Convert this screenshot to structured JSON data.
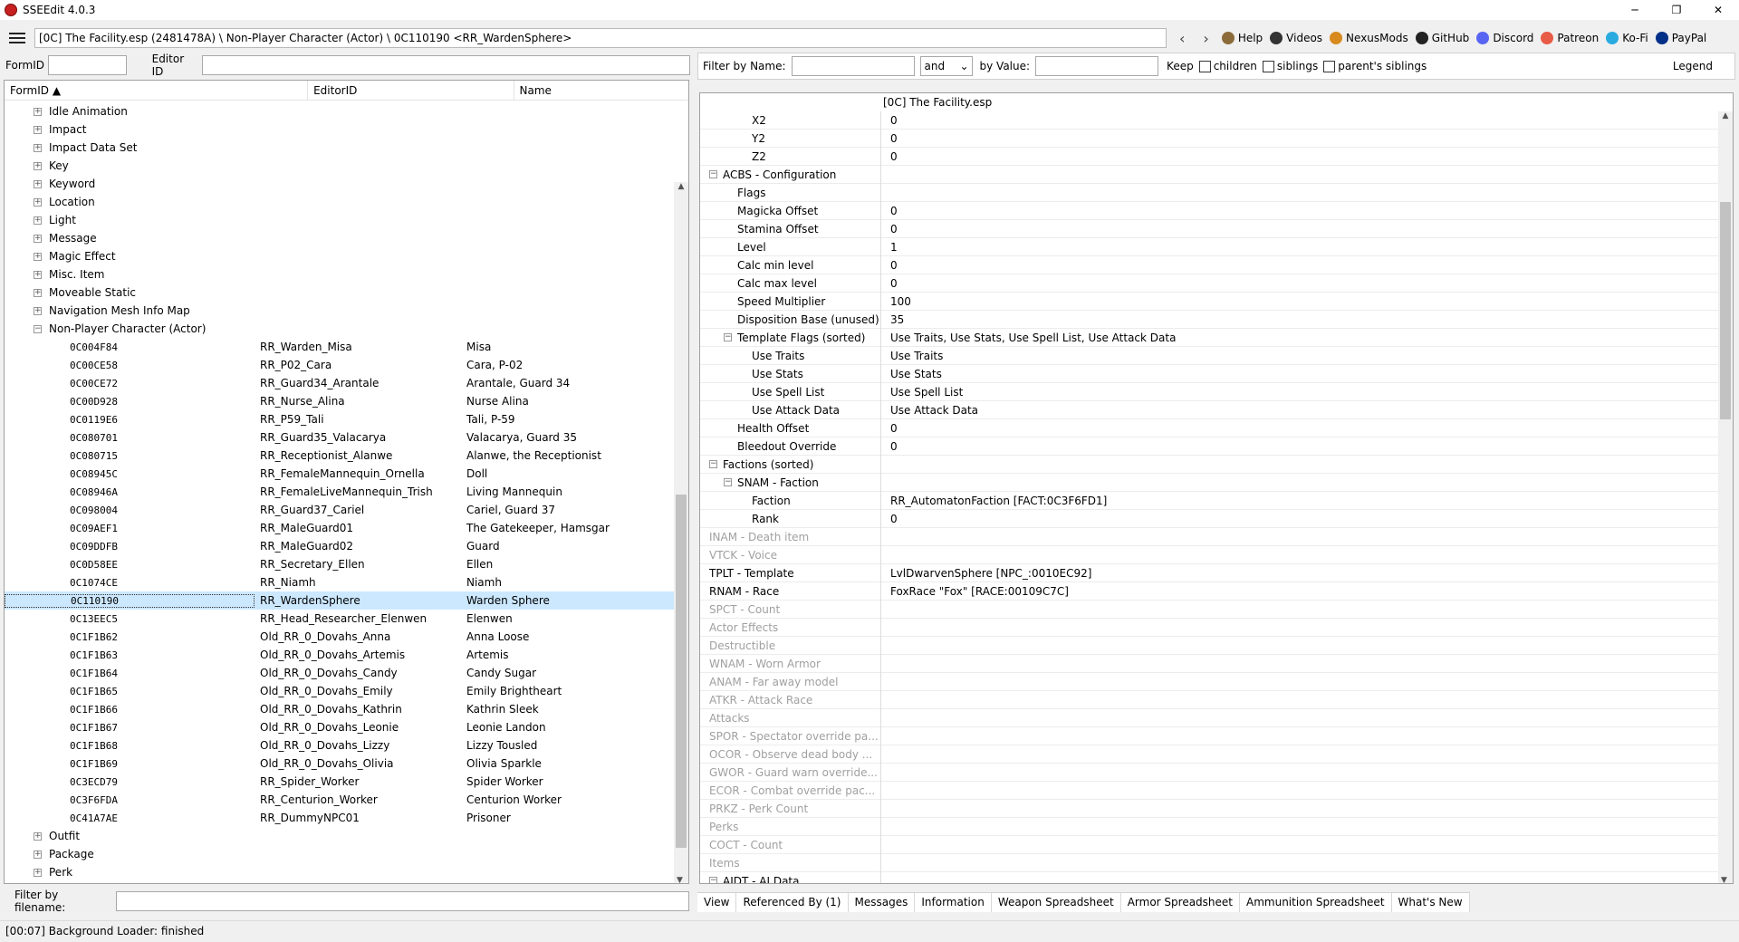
{
  "title": "SSEEdit 4.0.3",
  "path": "[0C] The Facility.esp (2481478A) \\ Non-Player Character (Actor) \\ 0C110190 <RR_WardenSphere>",
  "links": [
    {
      "label": "Help",
      "icon": "book-icon",
      "color": "#8b6b3a"
    },
    {
      "label": "Videos",
      "icon": "video-icon",
      "color": "#333333"
    },
    {
      "label": "NexusMods",
      "icon": "nexus-icon",
      "color": "#d98a1f"
    },
    {
      "label": "GitHub",
      "icon": "github-icon",
      "color": "#222222"
    },
    {
      "label": "Discord",
      "icon": "discord-icon",
      "color": "#5865f2"
    },
    {
      "label": "Patreon",
      "icon": "patreon-icon",
      "color": "#e85b46"
    },
    {
      "label": "Ko-Fi",
      "icon": "kofi-icon",
      "color": "#29abe0"
    },
    {
      "label": "PayPal",
      "icon": "paypal-icon",
      "color": "#003087"
    }
  ],
  "left": {
    "formid_label": "FormID",
    "editorid_label": "Editor ID",
    "columns": [
      "FormID",
      "EditorID",
      "Name"
    ],
    "categories_before": [
      "Idle Animation",
      "Impact",
      "Impact Data Set",
      "Key",
      "Keyword",
      "Location",
      "Light",
      "Message",
      "Magic Effect",
      "Misc. Item",
      "Moveable Static",
      "Navigation Mesh Info Map"
    ],
    "expanded_category": "Non-Player Character (Actor)",
    "npcs": [
      {
        "fid": "0C004F84",
        "eid": "RR_Warden_Misa",
        "name": "Misa"
      },
      {
        "fid": "0C00CE58",
        "eid": "RR_P02_Cara",
        "name": "Cara, P-02"
      },
      {
        "fid": "0C00CE72",
        "eid": "RR_Guard34_Arantale",
        "name": "Arantale, Guard 34"
      },
      {
        "fid": "0C00D928",
        "eid": "RR_Nurse_Alina",
        "name": "Nurse Alina"
      },
      {
        "fid": "0C0119E6",
        "eid": "RR_P59_Tali",
        "name": "Tali, P-59"
      },
      {
        "fid": "0C080701",
        "eid": "RR_Guard35_Valacarya",
        "name": "Valacarya, Guard 35"
      },
      {
        "fid": "0C080715",
        "eid": "RR_Receptionist_Alanwe",
        "name": "Alanwe, the Receptionist"
      },
      {
        "fid": "0C08945C",
        "eid": "RR_FemaleMannequin_Ornella",
        "name": "Doll"
      },
      {
        "fid": "0C08946A",
        "eid": "RR_FemaleLiveMannequin_Trish",
        "name": "Living Mannequin"
      },
      {
        "fid": "0C098004",
        "eid": "RR_Guard37_Cariel",
        "name": "Cariel, Guard 37"
      },
      {
        "fid": "0C09AEF1",
        "eid": "RR_MaleGuard01",
        "name": "The Gatekeeper, Hamsgar"
      },
      {
        "fid": "0C09DDFB",
        "eid": "RR_MaleGuard02",
        "name": "Guard"
      },
      {
        "fid": "0C0D58EE",
        "eid": "RR_Secretary_Ellen",
        "name": "Ellen"
      },
      {
        "fid": "0C1074CE",
        "eid": "RR_Niamh",
        "name": "Niamh"
      },
      {
        "fid": "0C110190",
        "eid": "RR_WardenSphere",
        "name": "Warden Sphere"
      },
      {
        "fid": "0C13EEC5",
        "eid": "RR_Head_Researcher_Elenwen",
        "name": "Elenwen"
      },
      {
        "fid": "0C1F1B62",
        "eid": "Old_RR_0_Dovahs_Anna",
        "name": "Anna Loose"
      },
      {
        "fid": "0C1F1B63",
        "eid": "Old_RR_0_Dovahs_Artemis",
        "name": "Artemis"
      },
      {
        "fid": "0C1F1B64",
        "eid": "Old_RR_0_Dovahs_Candy",
        "name": "Candy Sugar"
      },
      {
        "fid": "0C1F1B65",
        "eid": "Old_RR_0_Dovahs_Emily",
        "name": "Emily Brightheart"
      },
      {
        "fid": "0C1F1B66",
        "eid": "Old_RR_0_Dovahs_Kathrin",
        "name": "Kathrin Sleek"
      },
      {
        "fid": "0C1F1B67",
        "eid": "Old_RR_0_Dovahs_Leonie",
        "name": "Leonie Landon"
      },
      {
        "fid": "0C1F1B68",
        "eid": "Old_RR_0_Dovahs_Lizzy",
        "name": "Lizzy Tousled"
      },
      {
        "fid": "0C1F1B69",
        "eid": "Old_RR_0_Dovahs_Olivia",
        "name": "Olivia Sparkle"
      },
      {
        "fid": "0C3ECD79",
        "eid": "RR_Spider_Worker",
        "name": "Spider Worker"
      },
      {
        "fid": "0C3F6FDA",
        "eid": "RR_Centurion_Worker",
        "name": "Centurion Worker"
      },
      {
        "fid": "0C41A7AE",
        "eid": "RR_DummyNPC01",
        "name": "Prisoner"
      }
    ],
    "categories_after": [
      "Outfit",
      "Package",
      "Perk"
    ],
    "filter_label": "Filter by filename:"
  },
  "right": {
    "filter_name_label": "Filter by Name:",
    "and_option": "and",
    "by_value_label": "by Value:",
    "keep_label": "Keep",
    "children_label": "children",
    "siblings_label": "siblings",
    "parents_siblings_label": "parent's siblings",
    "legend_label": "Legend",
    "file_header": "[0C] The Facility.esp",
    "records": [
      {
        "label": "X2",
        "value": "0",
        "indent": 2,
        "exp": ""
      },
      {
        "label": "Y2",
        "value": "0",
        "indent": 2,
        "exp": ""
      },
      {
        "label": "Z2",
        "value": "0",
        "indent": 2,
        "exp": ""
      },
      {
        "label": "ACBS - Configuration",
        "value": "",
        "indent": 0,
        "exp": "−"
      },
      {
        "label": "Flags",
        "value": "",
        "indent": 1,
        "exp": ""
      },
      {
        "label": "Magicka Offset",
        "value": "0",
        "indent": 1,
        "exp": ""
      },
      {
        "label": "Stamina Offset",
        "value": "0",
        "indent": 1,
        "exp": ""
      },
      {
        "label": "Level",
        "value": "1",
        "indent": 1,
        "exp": ""
      },
      {
        "label": "Calc min level",
        "value": "0",
        "indent": 1,
        "exp": ""
      },
      {
        "label": "Calc max level",
        "value": "0",
        "indent": 1,
        "exp": ""
      },
      {
        "label": "Speed Multiplier",
        "value": "100",
        "indent": 1,
        "exp": ""
      },
      {
        "label": "Disposition Base (unused)",
        "value": "35",
        "indent": 1,
        "exp": ""
      },
      {
        "label": "Template Flags (sorted)",
        "value": "Use Traits, Use Stats, Use Spell List, Use Attack Data",
        "indent": 1,
        "exp": "−"
      },
      {
        "label": "Use Traits",
        "value": "Use Traits",
        "indent": 2,
        "exp": ""
      },
      {
        "label": "Use Stats",
        "value": "Use Stats",
        "indent": 2,
        "exp": ""
      },
      {
        "label": "Use Spell List",
        "value": "Use Spell List",
        "indent": 2,
        "exp": ""
      },
      {
        "label": "Use Attack Data",
        "value": "Use Attack Data",
        "indent": 2,
        "exp": ""
      },
      {
        "label": "Health Offset",
        "value": "0",
        "indent": 1,
        "exp": ""
      },
      {
        "label": "Bleedout Override",
        "value": "0",
        "indent": 1,
        "exp": ""
      },
      {
        "label": "Factions (sorted)",
        "value": "",
        "indent": 0,
        "exp": "−"
      },
      {
        "label": "SNAM - Faction",
        "value": "",
        "indent": 1,
        "exp": "−"
      },
      {
        "label": "Faction",
        "value": "RR_AutomatonFaction [FACT:0C3F6FD1]",
        "indent": 2,
        "exp": ""
      },
      {
        "label": "Rank",
        "value": "0",
        "indent": 2,
        "exp": ""
      },
      {
        "label": "INAM - Death item",
        "value": "",
        "indent": 0,
        "exp": "",
        "dim": true
      },
      {
        "label": "VTCK - Voice",
        "value": "",
        "indent": 0,
        "exp": "",
        "dim": true
      },
      {
        "label": "TPLT - Template",
        "value": "LvlDwarvenSphere [NPC_:0010EC92]",
        "indent": 0,
        "exp": ""
      },
      {
        "label": "RNAM - Race",
        "value": "FoxRace \"Fox\" [RACE:00109C7C]",
        "indent": 0,
        "exp": ""
      },
      {
        "label": "SPCT - Count",
        "value": "",
        "indent": 0,
        "exp": "",
        "dim": true
      },
      {
        "label": "Actor Effects",
        "value": "",
        "indent": 0,
        "exp": "",
        "dim": true
      },
      {
        "label": "Destructible",
        "value": "",
        "indent": 0,
        "exp": "",
        "dim": true
      },
      {
        "label": "WNAM - Worn Armor",
        "value": "",
        "indent": 0,
        "exp": "",
        "dim": true
      },
      {
        "label": "ANAM - Far away model",
        "value": "",
        "indent": 0,
        "exp": "",
        "dim": true
      },
      {
        "label": "ATKR - Attack Race",
        "value": "",
        "indent": 0,
        "exp": "",
        "dim": true
      },
      {
        "label": "Attacks",
        "value": "",
        "indent": 0,
        "exp": "",
        "dim": true
      },
      {
        "label": "SPOR - Spectator override pa...",
        "value": "",
        "indent": 0,
        "exp": "",
        "dim": true
      },
      {
        "label": "OCOR - Observe dead body ...",
        "value": "",
        "indent": 0,
        "exp": "",
        "dim": true
      },
      {
        "label": "GWOR - Guard warn override...",
        "value": "",
        "indent": 0,
        "exp": "",
        "dim": true
      },
      {
        "label": "ECOR - Combat override pac...",
        "value": "",
        "indent": 0,
        "exp": "",
        "dim": true
      },
      {
        "label": "PRKZ - Perk Count",
        "value": "",
        "indent": 0,
        "exp": "",
        "dim": true
      },
      {
        "label": "Perks",
        "value": "",
        "indent": 0,
        "exp": "",
        "dim": true
      },
      {
        "label": "COCT - Count",
        "value": "",
        "indent": 0,
        "exp": "",
        "dim": true
      },
      {
        "label": "Items",
        "value": "",
        "indent": 0,
        "exp": "",
        "dim": true
      },
      {
        "label": "AIDT - AI Data",
        "value": "",
        "indent": 0,
        "exp": "−"
      }
    ],
    "tabs": [
      "View",
      "Referenced By (1)",
      "Messages",
      "Information",
      "Weapon Spreadsheet",
      "Armor Spreadsheet",
      "Ammunition Spreadsheet",
      "What's New"
    ]
  },
  "status": "[00:07] Background Loader: finished"
}
